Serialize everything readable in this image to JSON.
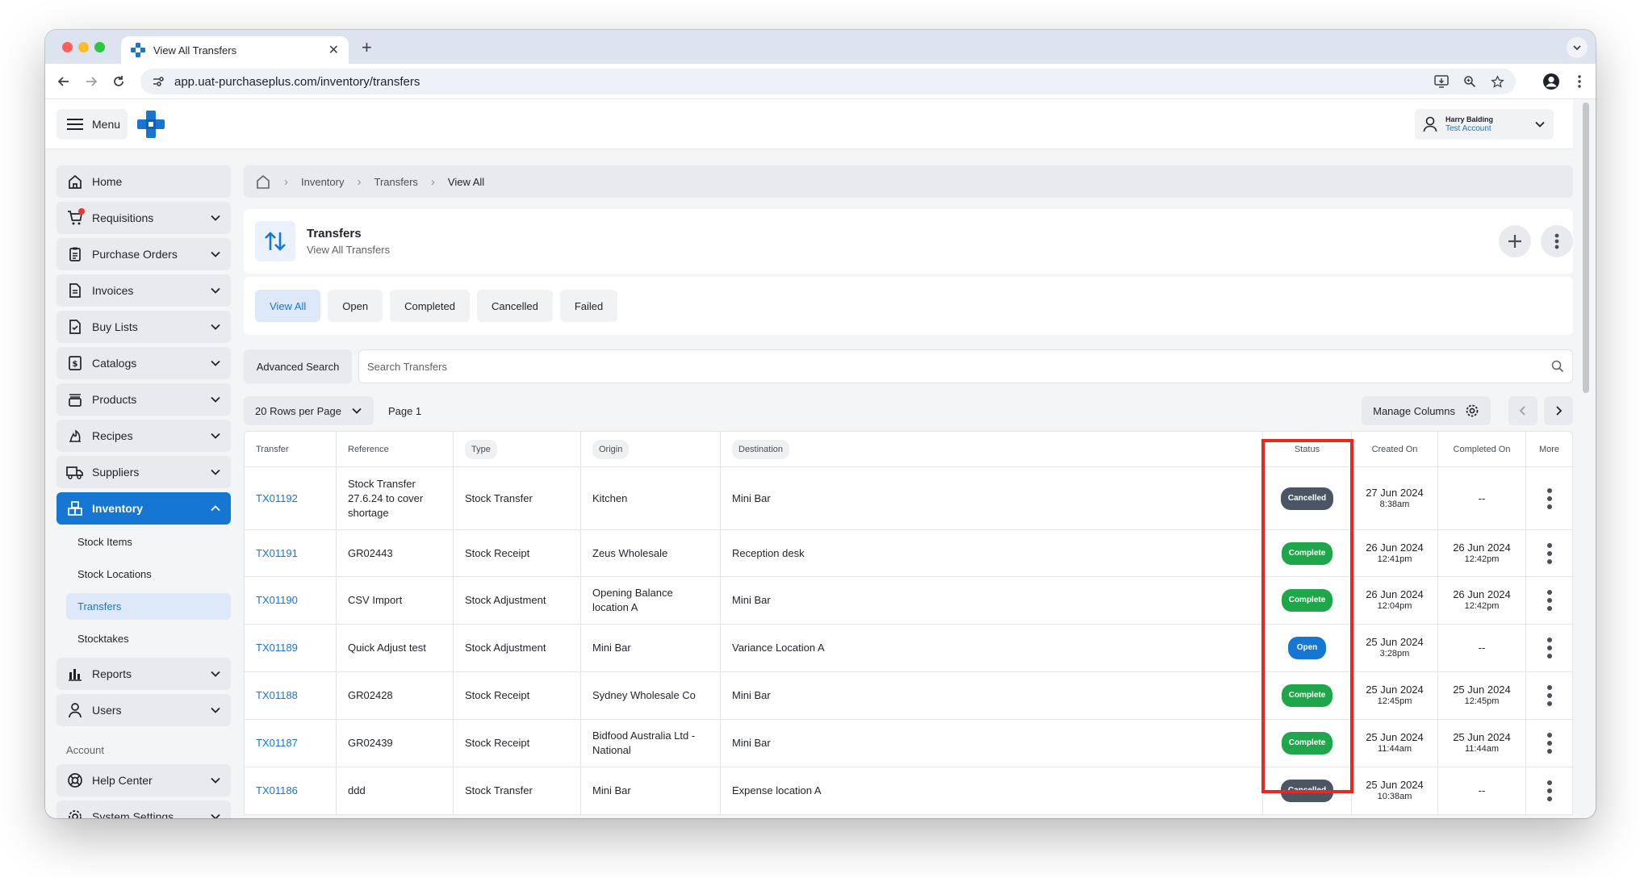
{
  "browser": {
    "tab_title": "View All Transfers",
    "new_tab": "+",
    "url": "app.uat-purchaseplus.com/inventory/transfers"
  },
  "header": {
    "menu_label": "Menu",
    "user_name": "Harry Balding",
    "user_account": "Test Account"
  },
  "sidebar": {
    "items": [
      {
        "label": "Home",
        "icon": "home-icon"
      },
      {
        "label": "Requisitions",
        "icon": "cart-icon"
      },
      {
        "label": "Purchase Orders",
        "icon": "clipboard-icon"
      },
      {
        "label": "Invoices",
        "icon": "document-icon"
      },
      {
        "label": "Buy Lists",
        "icon": "checklist-icon"
      },
      {
        "label": "Catalogs",
        "icon": "dollar-doc-icon"
      },
      {
        "label": "Products",
        "icon": "stack-icon"
      },
      {
        "label": "Recipes",
        "icon": "flame-icon"
      },
      {
        "label": "Suppliers",
        "icon": "truck-icon"
      },
      {
        "label": "Inventory",
        "icon": "boxes-icon"
      }
    ],
    "inventory_sub": [
      "Stock Items",
      "Stock Locations",
      "Transfers",
      "Stocktakes"
    ],
    "items_after": [
      {
        "label": "Reports",
        "icon": "bar-chart-icon"
      },
      {
        "label": "Users",
        "icon": "user-icon"
      }
    ],
    "account_section": "Account",
    "help_center": "Help Center",
    "system_settings": "System Settings"
  },
  "breadcrumb": {
    "items": [
      "Inventory",
      "Transfers",
      "View All"
    ]
  },
  "title": {
    "main": "Transfers",
    "sub": "View All Transfers"
  },
  "filters": [
    "View All",
    "Open",
    "Completed",
    "Cancelled",
    "Failed"
  ],
  "search": {
    "advanced_label": "Advanced Search",
    "placeholder": "Search Transfers"
  },
  "pager": {
    "rows_label": "20 Rows per Page",
    "page_label": "Page 1",
    "manage_columns": "Manage Columns"
  },
  "table": {
    "headers": [
      "Transfer",
      "Reference",
      "Type",
      "Origin",
      "Destination",
      "Status",
      "Created On",
      "Completed On",
      "More"
    ],
    "rows": [
      {
        "transfer": "TX01192",
        "reference": "Stock Transfer 27.6.24 to cover shortage",
        "type": "Stock Transfer",
        "origin": "Kitchen",
        "destination": "Mini Bar",
        "status": "Cancelled",
        "created_date": "27 Jun 2024",
        "created_time": "8:38am",
        "completed_date": "--",
        "completed_time": ""
      },
      {
        "transfer": "TX01191",
        "reference": "GR02443",
        "type": "Stock Receipt",
        "origin": "Zeus Wholesale",
        "destination": "Reception desk",
        "status": "Complete",
        "created_date": "26 Jun 2024",
        "created_time": "12:41pm",
        "completed_date": "26 Jun 2024",
        "completed_time": "12:42pm"
      },
      {
        "transfer": "TX01190",
        "reference": "CSV Import",
        "type": "Stock Adjustment",
        "origin": "Opening Balance location A",
        "destination": "Mini Bar",
        "status": "Complete",
        "created_date": "26 Jun 2024",
        "created_time": "12:04pm",
        "completed_date": "26 Jun 2024",
        "completed_time": "12:42pm"
      },
      {
        "transfer": "TX01189",
        "reference": "Quick Adjust test",
        "type": "Stock Adjustment",
        "origin": "Mini Bar",
        "destination": "Variance Location A",
        "status": "Open",
        "created_date": "25 Jun 2024",
        "created_time": "3:28pm",
        "completed_date": "--",
        "completed_time": ""
      },
      {
        "transfer": "TX01188",
        "reference": "GR02428",
        "type": "Stock Receipt",
        "origin": "Sydney Wholesale Co",
        "destination": "Mini Bar",
        "status": "Complete",
        "created_date": "25 Jun 2024",
        "created_time": "12:45pm",
        "completed_date": "25 Jun 2024",
        "completed_time": "12:45pm"
      },
      {
        "transfer": "TX01187",
        "reference": "GR02439",
        "type": "Stock Receipt",
        "origin": "Bidfood Australia Ltd - National",
        "destination": "Mini Bar",
        "status": "Complete",
        "created_date": "25 Jun 2024",
        "created_time": "11:44am",
        "completed_date": "25 Jun 2024",
        "completed_time": "11:44am"
      },
      {
        "transfer": "TX01186",
        "reference": "ddd",
        "type": "Stock Transfer",
        "origin": "Mini Bar",
        "destination": "Expense location A",
        "status": "Cancelled",
        "created_date": "25 Jun 2024",
        "created_time": "10:38am",
        "completed_date": "--",
        "completed_time": ""
      }
    ]
  },
  "colors": {
    "accent": "#1677d2",
    "complete": "#1fa64a",
    "cancelled": "#4b5563",
    "highlight": "#e8281e"
  }
}
